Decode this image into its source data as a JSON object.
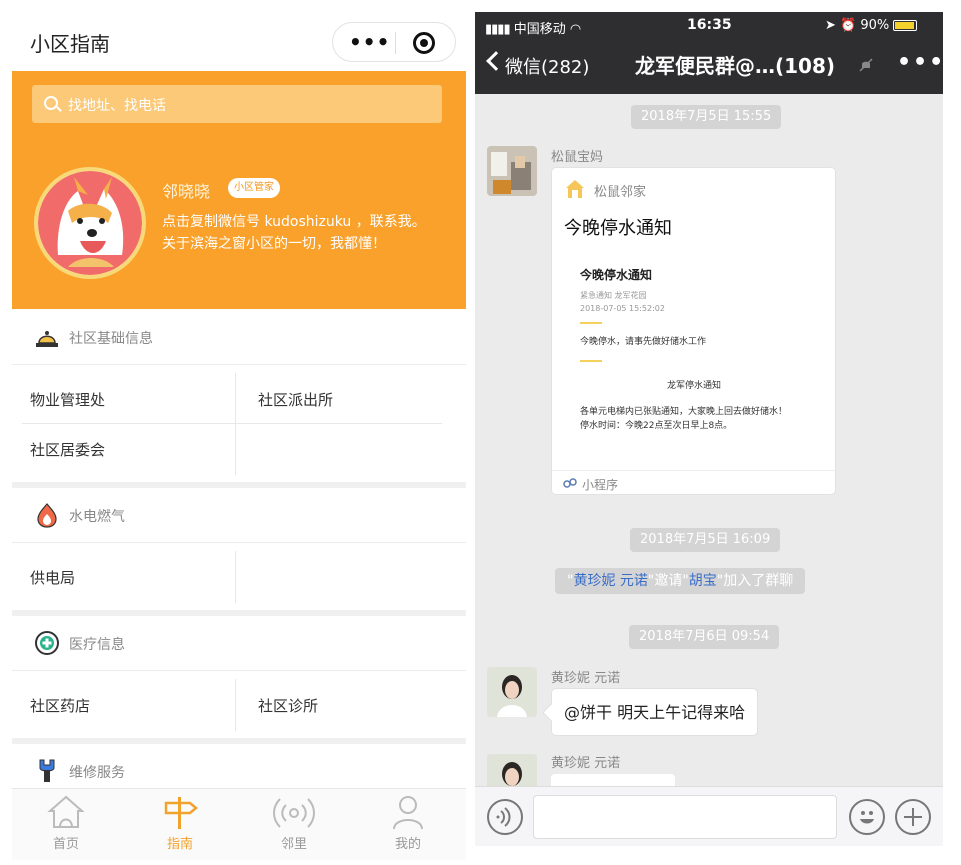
{
  "left": {
    "title": "小区指南",
    "capsule": {
      "more": "•••"
    },
    "search": {
      "placeholder": "找地址、找电话"
    },
    "manager": {
      "name": "邻晓晓",
      "badge": "小区管家",
      "desc_pre": "点击复制微信号 ",
      "wechat_id": "kudoshizuku",
      "desc_post": " ，联系我。 关于滨海之窗小区的一切，我都懂！"
    },
    "sections": [
      {
        "icon": "bell-icon",
        "label": "社区基础信息",
        "items": [
          "物业管理处",
          "社区派出所",
          "社区居委会"
        ]
      },
      {
        "icon": "flame-icon",
        "label": "水电燃气",
        "items": [
          "供电局"
        ]
      },
      {
        "icon": "medical-icon",
        "label": "医疗信息",
        "items": [
          "社区药店",
          "社区诊所"
        ]
      },
      {
        "icon": "wrench-icon",
        "label": "维修服务",
        "items": []
      }
    ],
    "tabs": [
      {
        "label": "首页",
        "icon": "home-icon",
        "active": false
      },
      {
        "label": "指南",
        "icon": "signpost-icon",
        "active": true
      },
      {
        "label": "邻里",
        "icon": "broadcast-icon",
        "active": false
      },
      {
        "label": "我的",
        "icon": "person-icon",
        "active": false
      }
    ],
    "colors": {
      "accent": "#f9a12b",
      "active_tab": "#f0a22c"
    }
  },
  "right": {
    "status": {
      "carrier": "中国移动",
      "time": "16:35",
      "battery": "90%"
    },
    "chat": {
      "back_label": "微信(282)",
      "title": "龙军便民群@…(108)",
      "more": "•••"
    },
    "timestamps": [
      "2018年7月5日 15:55",
      "2018年7月5日 16:09",
      "2018年7月6日 09:54"
    ],
    "card": {
      "sender": "松鼠宝妈",
      "source": "松鼠邻家",
      "title": "今晚停水通知",
      "preview": {
        "title": "今晚停水通知",
        "meta": "紧急通知   龙军花园",
        "time": "2018-07-05 15:52:02",
        "line1": "今晚停水，请事先做好储水工作",
        "heading": "龙军停水通知",
        "body1": "各单元电梯内已张贴通知，大家晚上回去做好储水！",
        "body2": "停水时间：今晚22点至次日早上8点。"
      },
      "footer": "小程序"
    },
    "system": {
      "q1": "\"",
      "name1": "黄珍妮 元诺",
      "mid": "\"邀请\"",
      "name2": "胡宝",
      "tail": "\"加入了群聊"
    },
    "messages": [
      {
        "sender": "黄珍妮 元诺",
        "text": "@饼干 明天上午记得来哈"
      },
      {
        "sender": "黄珍妮 元诺"
      }
    ]
  }
}
